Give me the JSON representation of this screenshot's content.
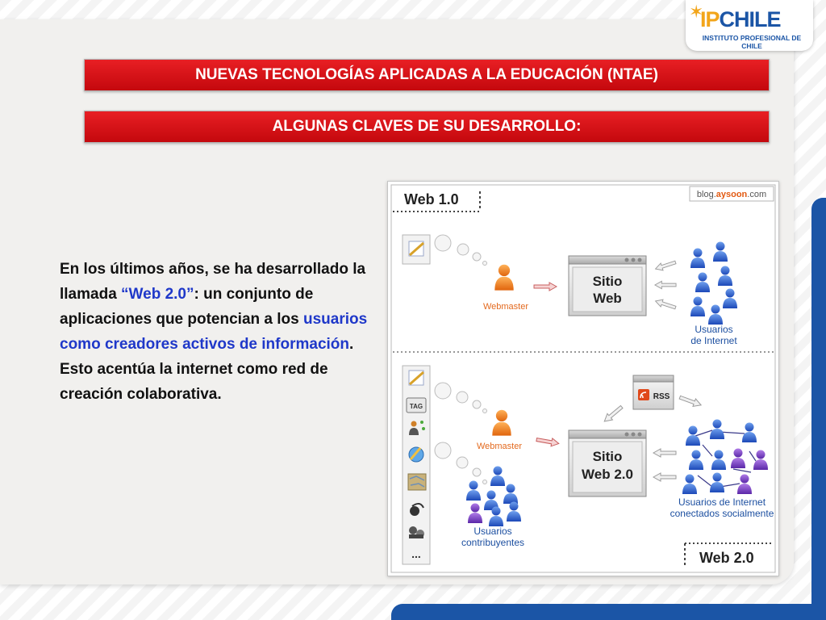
{
  "logo": {
    "brand_ip": "IP",
    "brand_chile": "CHILE",
    "subtitle": "INSTITUTO PROFESIONAL DE CHILE"
  },
  "header": {
    "title": "NUEVAS TECNOLOGÍAS APLICADAS A LA EDUCACIÓN (NTAE)",
    "subtitle": "ALGUNAS CLAVES DE SU DESARROLLO:"
  },
  "body": {
    "p1": "En los últimos años, se ha desarrollado la llamada ",
    "web20": "“Web 2.0”",
    "p2": ": un conjunto de aplicaciones que potencian a los ",
    "highlight": "usuarios como creadores activos de información",
    "p3": ". Esto acentúa la internet como red de creación colaborativa."
  },
  "diagram": {
    "web1_label": "Web 1.0",
    "blog_prefix": "blog.",
    "blog_brand": "aysoon",
    "blog_suffix": ".com",
    "webmaster_1": "Webmaster",
    "sitio_web_line1": "Sitio",
    "sitio_web_line2": "Web",
    "usuarios_line1": "Usuarios",
    "usuarios_line2": "de Internet",
    "webmaster_2": "Webmaster",
    "sitio_web2_line1": "Sitio",
    "sitio_web2_line2": "Web 2.0",
    "rss": "RSS",
    "tag": "TAG",
    "more": "...",
    "contrib_line1": "Usuarios",
    "contrib_line2": "contribuyentes",
    "social_line1": "Usuarios de Internet",
    "social_line2": "conectados socialmente",
    "web2_label": "Web 2.0"
  },
  "colors": {
    "red_bar": "#d9141a",
    "blue_text": "#1f38c9",
    "accent_blue": "#1b55a6",
    "orange": "#f2a51a",
    "label_blue": "#1c4fa0",
    "label_orange": "#e3691e"
  }
}
